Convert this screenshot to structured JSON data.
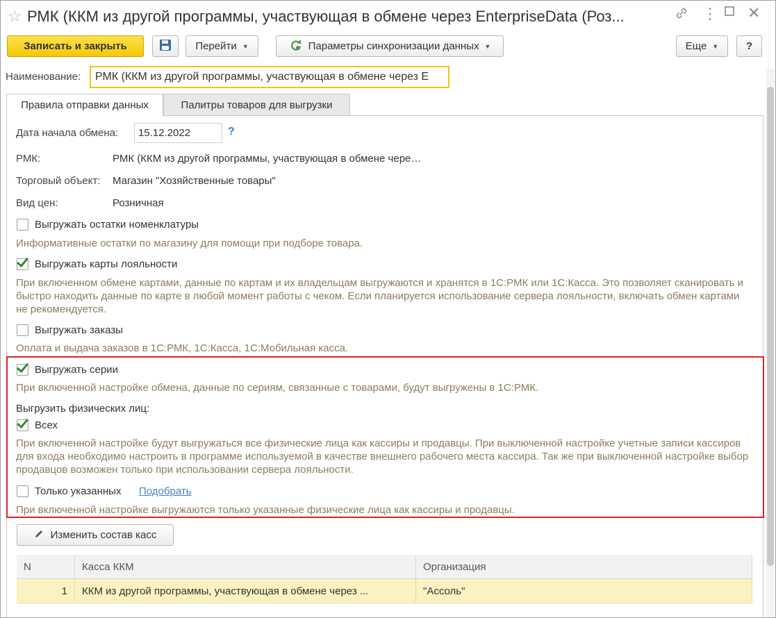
{
  "window": {
    "title": "РМК (ККМ из другой программы, участвующая в обмене через EnterpriseData (Роз..."
  },
  "toolbar": {
    "save_close": "Записать и закрыть",
    "goto": "Перейти",
    "sync_params": "Параметры синхронизации данных",
    "more": "Еще",
    "help": "?"
  },
  "name_field": {
    "label": "Наименование:",
    "value": "РМК (ККМ из другой программы, участвующая в обмене через E"
  },
  "tabs": [
    {
      "label": "Правила отправки данных",
      "active": true
    },
    {
      "label": "Палитры товаров для выгрузки",
      "active": false
    }
  ],
  "form": {
    "start_date_label": "Дата начала обмена:",
    "start_date_value": "15.12.2022",
    "start_date_help": "?",
    "rmk_label": "РМК:",
    "rmk_value": "РМК (ККМ из другой программы, участвующая в обмене чере…",
    "store_label": "Торговый объект:",
    "store_value": "Магазин \"Хозяйственные товары\"",
    "price_label": "Вид цен:",
    "price_value": "Розничная",
    "export_stock": {
      "label": "Выгружать остатки номенклатуры",
      "checked": false,
      "hint": "Информативные остатки по магазину для помощи при подборе товара."
    },
    "export_loyalty": {
      "label": "Выгружать карты лояльности",
      "checked": true,
      "hint": "При включенном обмене картами, данные по картам и их владельцам выгружаются и хранятся в 1С:РМК или 1С:Касса. Это позволяет сканировать и быстро находить данные по карте в любой момент работы с чеком. Если планируется использование сервера лояльности, включать обмен картами не рекомендуется."
    },
    "export_orders": {
      "label": "Выгружать заказы",
      "checked": false,
      "hint": "Оплата и выдача заказов в 1С:РМК, 1С:Касса, 1С:Мобильная касса."
    },
    "export_series": {
      "label": "Выгружать серии",
      "checked": true,
      "hint": "При включенной настройке обмена, данные по сериям, связанные с товарами, будут выгружены в 1С:РМК."
    },
    "persons_heading": "Выгрузить физических лиц:",
    "persons_all": {
      "label": "Всех",
      "checked": true,
      "hint": "При включенной настройке будут выгружаться все физические лица как кассиры и продавцы. При выключенной настройке учетные записи кассиров для входа необходимо настроить в программе используемой в качестве внешнего рабочего места кассира. Так же при выключенной настройке выбор продавцов возможен только при использовании сервера лояльности."
    },
    "persons_only": {
      "label": "Только указанных",
      "checked": false,
      "link": "Подобрать",
      "hint": "При включенной настройке выгружаются только указанные физические лица как кассиры и продавцы."
    },
    "change_registers_button": "Изменить состав касс"
  },
  "table": {
    "columns": [
      "N",
      "Касса ККМ",
      "Организация"
    ],
    "rows": [
      [
        "1",
        "ККМ из другой программы, участвующая в обмене через ...",
        "\"Ассоль\""
      ]
    ]
  },
  "colors": {
    "primary_button": "#f4c808",
    "highlight_frame": "#e02020",
    "hint_text": "#8b7d5c",
    "selected_row": "#fbf2c2"
  }
}
